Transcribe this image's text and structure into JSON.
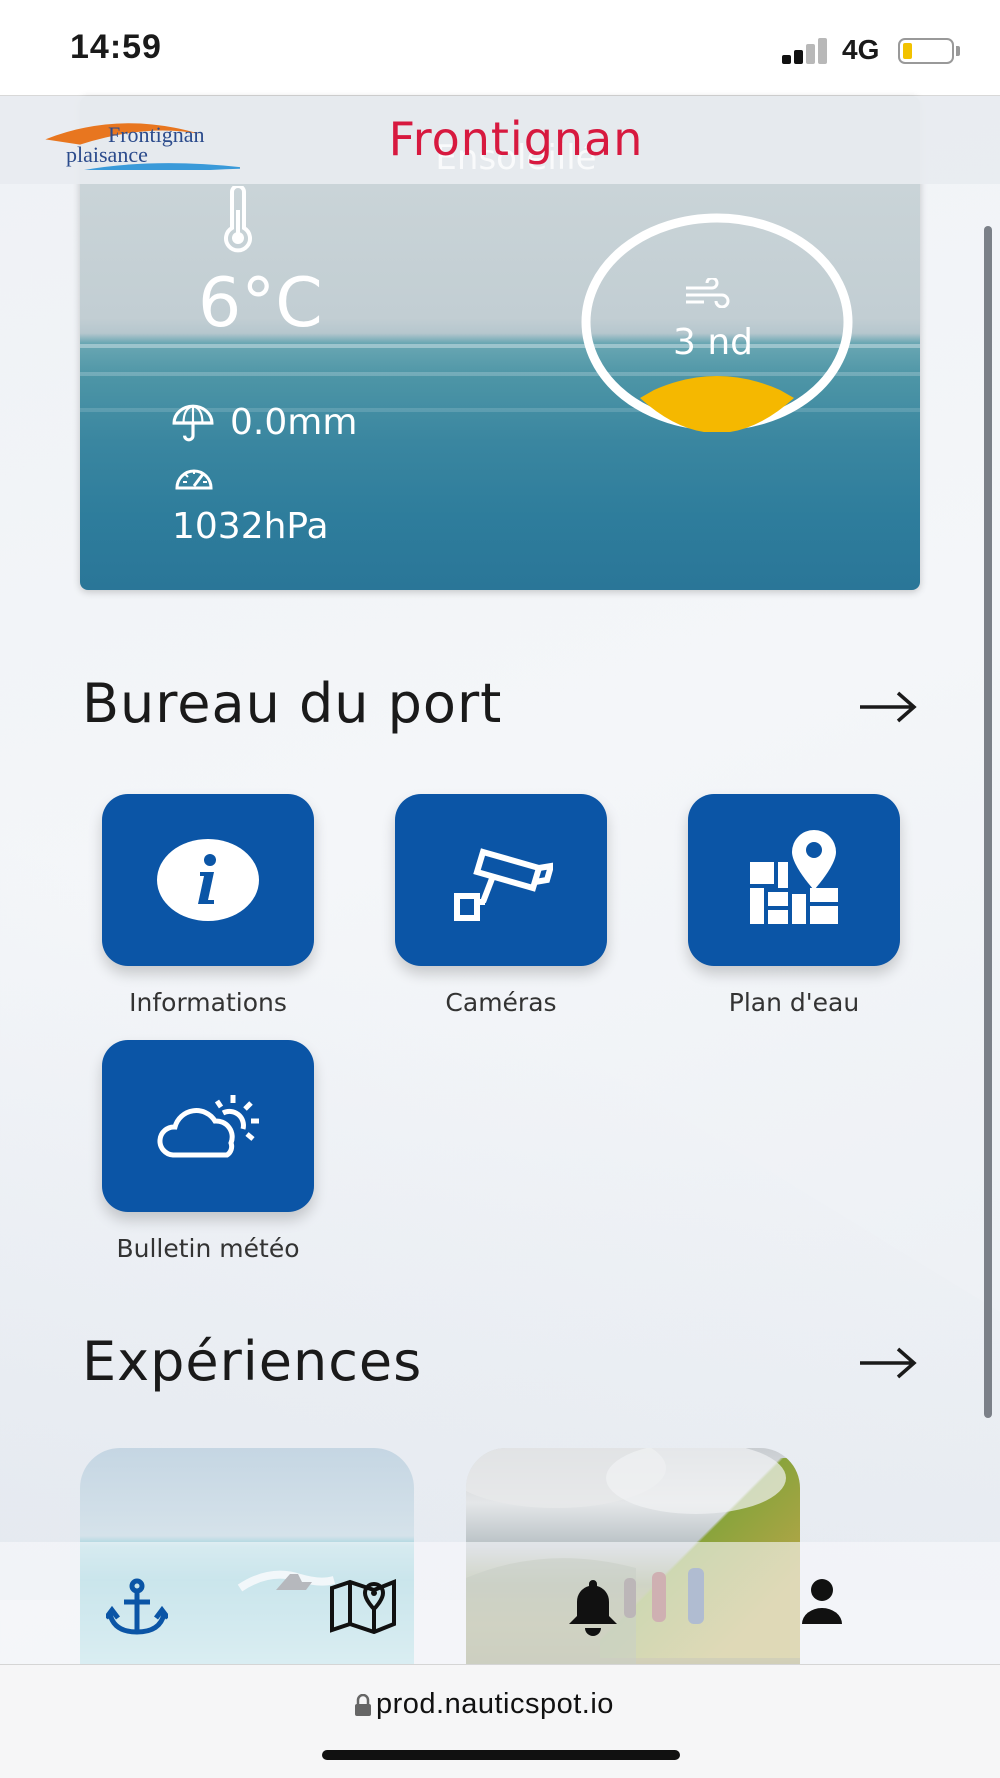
{
  "status_bar": {
    "time": "14:59",
    "network": "4G",
    "battery_level": 0.15,
    "battery_color": "#f2c200"
  },
  "header": {
    "logo_line1": "Frontignan",
    "logo_line2": "plaisance",
    "title": "Frontignan",
    "subtitle": "Ensoleillé",
    "title_color": "#d7193f"
  },
  "weather": {
    "temperature": "6°C",
    "rain": "0.0mm",
    "pressure": "1032hPa",
    "wind": "3 nd",
    "wind_gauge_color": "#f5b800",
    "icons": [
      "thermometer-icon",
      "umbrella-icon",
      "gauge-icon",
      "wind-icon"
    ]
  },
  "bureau": {
    "title": "Bureau du port",
    "tiles": [
      {
        "label": "Informations",
        "icon": "info-icon"
      },
      {
        "label": "Caméras",
        "icon": "camera-icon"
      },
      {
        "label": "Plan d'eau",
        "icon": "map-pin-icon"
      },
      {
        "label": "Bulletin météo",
        "icon": "weather-icon"
      }
    ],
    "tile_color": "#0b55a6"
  },
  "experiences": {
    "title": "Expériences"
  },
  "bottom_nav": {
    "items": [
      "anchor-icon",
      "map-icon",
      "bell-icon",
      "user-icon"
    ],
    "accent": "#0b55a6"
  },
  "url_bar": {
    "url": "prod.nauticspot.io"
  }
}
